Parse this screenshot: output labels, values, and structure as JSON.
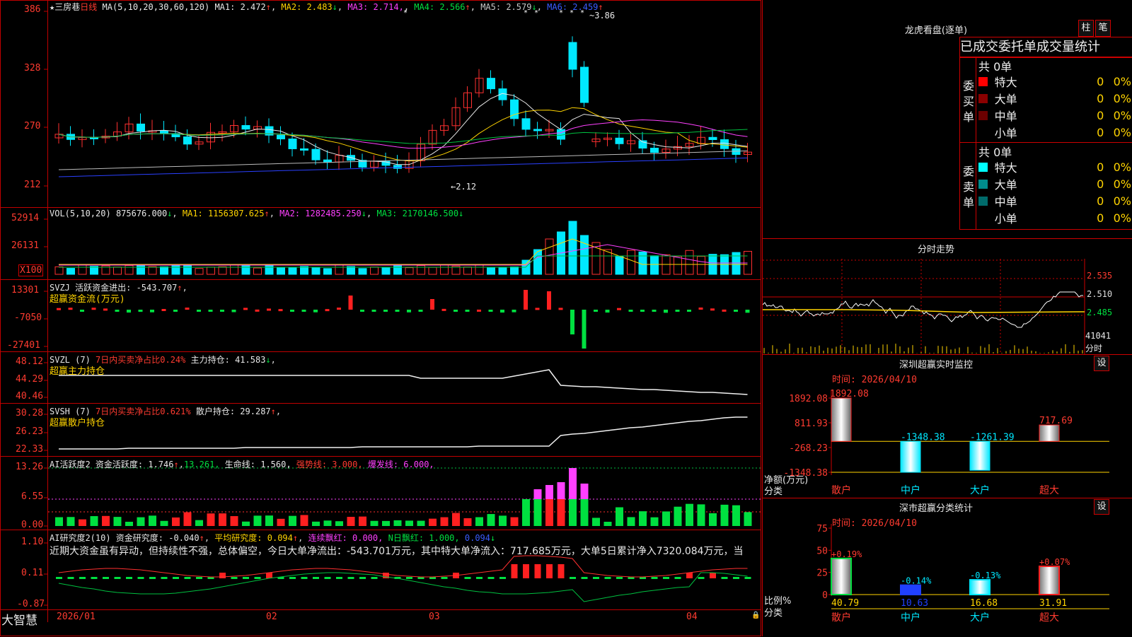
{
  "footer": {
    "brand": "大智慧"
  },
  "main": {
    "stock_name": "三房巷",
    "period": "日线",
    "ma": {
      "label": "MA(5,10,20,30,60,120)",
      "items": [
        {
          "name": "MA1:",
          "value": "2.472",
          "arrow": "↑",
          "color": "#e8e8e8",
          "arrow_color": "#ff3b30"
        },
        {
          "name": "MA2:",
          "value": "2.483",
          "arrow": "↓",
          "color": "#ffd400",
          "arrow_color": "#00e040"
        },
        {
          "name": "MA3:",
          "value": "2.714",
          "arrow": ",",
          "color": "#ff40ff",
          "arrow_color": "#ff40ff"
        },
        {
          "name": "MA4:",
          "value": "2.566",
          "arrow": "↑",
          "color": "#00e040",
          "arrow_color": "#ff3b30"
        },
        {
          "name": "MA5:",
          "value": "2.579",
          "arrow": "↓",
          "color": "#c8c8c8",
          "arrow_color": "#00e040"
        },
        {
          "name": "MA6:",
          "value": "2.459",
          "arrow": "↑",
          "color": "#3a5cff",
          "arrow_color": "#ff3b30"
        }
      ]
    },
    "y_ticks": [
      "386",
      "328",
      "270",
      "212"
    ],
    "high_label": "3.86",
    "low_label": "2.12"
  },
  "vol": {
    "header": "VOL(5,10,20)",
    "value": "875676.000",
    "ma1": "1156307.625",
    "ma2": "1282485.250",
    "ma3": "2170146.500",
    "y_ticks": [
      "52914",
      "26131"
    ],
    "unit": "X100"
  },
  "svzj": {
    "header": "SVZJ  活跃资金进出: -543.707",
    "subtitle": "超赢资金流(万元)",
    "y_ticks": [
      "13301",
      "-7050",
      "-27401"
    ]
  },
  "svzl": {
    "header1": "SVZL (7)",
    "header2": "7日内买卖净占比0.24%",
    "header3": "主力持仓: 41.583",
    "subtitle": "超赢主力持仓",
    "y_ticks": [
      "48.12",
      "44.29",
      "40.46"
    ]
  },
  "svsh": {
    "header1": "SVSH (7)",
    "header2": "7日内买卖净占比0.621%",
    "header3": "散户持仓: 29.287",
    "subtitle": "超赢散户持仓",
    "y_ticks": [
      "30.28",
      "26.23",
      "22.33"
    ]
  },
  "ai1": {
    "header1": "AI活跃度2 资金活跃度: 1.746",
    "header2": "13.261,",
    "header3": "生命线: 1.560,",
    "header4": "强势线: 3.000,",
    "header5": "爆发线: 6.000,",
    "y_ticks": [
      "13.26",
      "6.55",
      "0.00"
    ]
  },
  "ai2": {
    "header1": "AI研究度2(10) 资金研究度: -0.040",
    "header2": "平均研究度: 0.094",
    "header3": "连续飘红: 0.000,",
    "header4": "N日飘红: 1.000,",
    "header5": "0.094",
    "comment": "近期大资金虽有异动，但持续性不强，总体偏空，今日大单净流出：-543.701万元，其中特大单净流入：717.685万元，大单5日累计净入7320.084万元，当",
    "y_ticks": [
      "1.10",
      "0.11",
      "-0.87"
    ]
  },
  "x_axis": {
    "labels": [
      "2026/01",
      "02",
      "03",
      "04"
    ]
  },
  "lhb": {
    "title": "龙虎看盘(逐单)",
    "btn_column": "柱",
    "btn_tick": "笔",
    "section_title": "已成交委托单成交量统计",
    "buy": {
      "side_label": "委买单",
      "total": "共 0单",
      "rows": [
        {
          "label": "特大",
          "count": "0",
          "pct": "0%",
          "color": "#ff0000"
        },
        {
          "label": "大单",
          "count": "0",
          "pct": "0%",
          "color": "#8b0000"
        },
        {
          "label": "中单",
          "count": "0",
          "pct": "0%",
          "color": "#6b0000"
        },
        {
          "label": "小单",
          "count": "0",
          "pct": "0%",
          "color": "#000000"
        }
      ]
    },
    "sell": {
      "side_label": "委卖单",
      "total": "共 0单",
      "rows": [
        {
          "label": "特大",
          "count": "0",
          "pct": "0%",
          "color": "#00ffff"
        },
        {
          "label": "大单",
          "count": "0",
          "pct": "0%",
          "color": "#008b8b"
        },
        {
          "label": "中单",
          "count": "0",
          "pct": "0%",
          "color": "#006b6b"
        },
        {
          "label": "小单",
          "count": "0",
          "pct": "0%",
          "color": "#000000"
        }
      ]
    }
  },
  "intraday": {
    "title": "分时走势",
    "price_ticks": [
      "2.535",
      "2.510",
      "2.485"
    ],
    "vol_tick": "41041",
    "vol_unit": "分时"
  },
  "monitor": {
    "title": "深圳超赢实时监控",
    "btn": "设",
    "time": "时间: 2026/04/10",
    "y_ticks": [
      "1892.08",
      "811.93",
      "-268.23",
      "-1348.38"
    ],
    "y_label": "净额(万元)",
    "x_title": "分类",
    "categories": [
      "散户",
      "中户",
      "大户",
      "超大"
    ],
    "values": [
      1892.08,
      -1348.38,
      -1261.39,
      717.69
    ],
    "value_labels": [
      "1892.08",
      "-1348.38",
      "-1261.39",
      "717.69"
    ]
  },
  "classify": {
    "title": "深市超赢分类统计",
    "btn": "设",
    "time": "时间: 2026/04/10",
    "y_ticks": [
      "75",
      "50",
      "25",
      "0"
    ],
    "y_label": "比例%",
    "x_title": "分类",
    "categories": [
      "散户",
      "中户",
      "大户",
      "超大"
    ],
    "values": [
      40.79,
      10.63,
      16.68,
      31.91
    ],
    "changes": [
      "+0.19%",
      "-0.14%",
      "-0.13%",
      "+0.07%"
    ]
  }
}
